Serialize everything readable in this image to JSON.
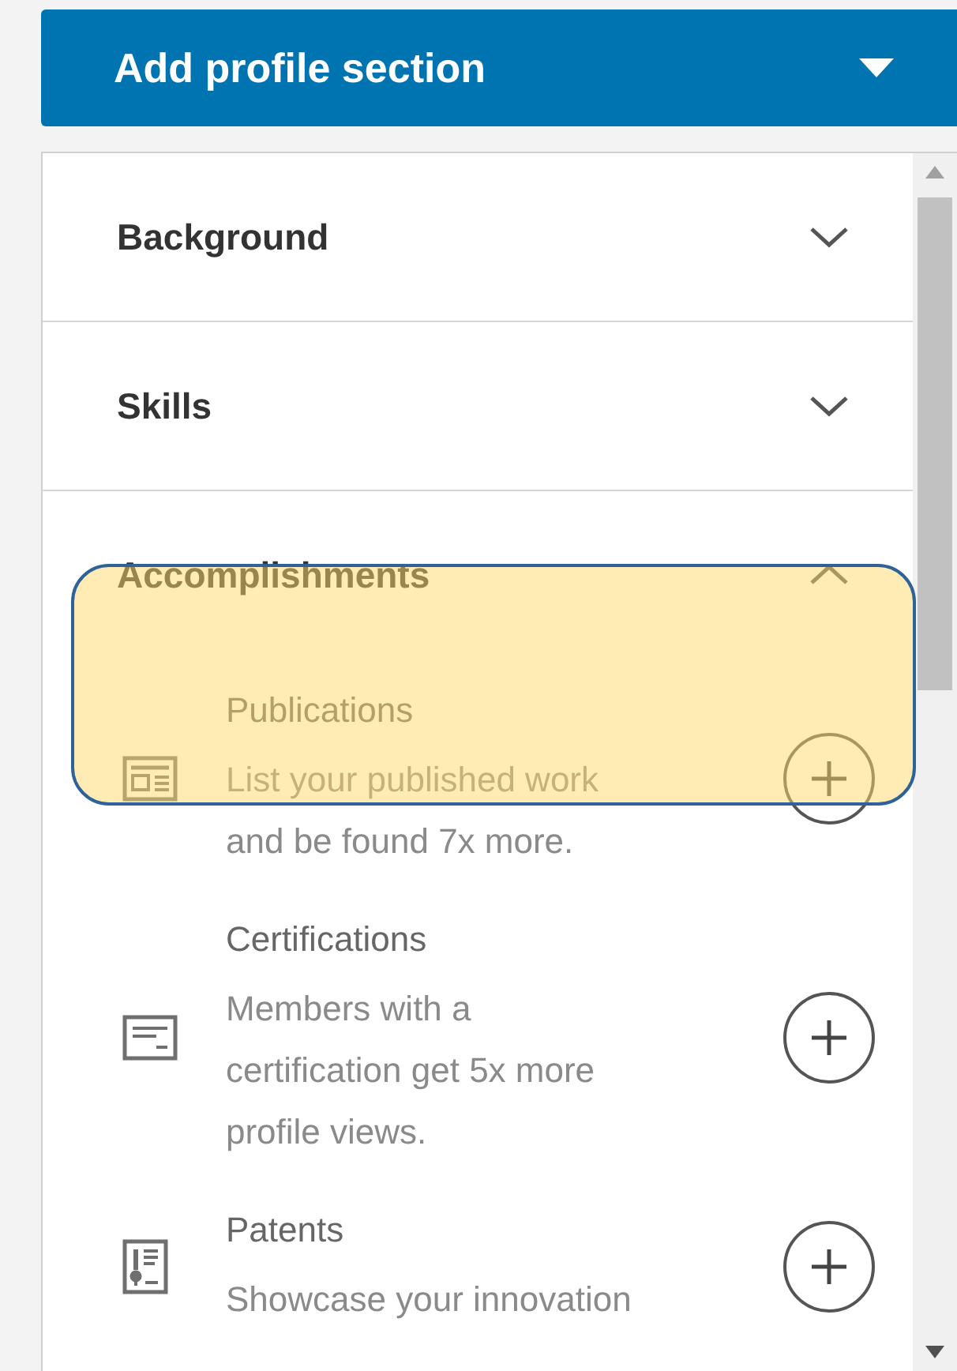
{
  "header_button": {
    "label": "Add profile section"
  },
  "sections": [
    {
      "title": "Background",
      "expanded": false
    },
    {
      "title": "Skills",
      "expanded": false
    },
    {
      "title": "Accomplishments",
      "expanded": true,
      "items": [
        {
          "kind": "publication",
          "title": "Publications",
          "description": "List your published work and be found 7x more."
        },
        {
          "kind": "certification",
          "title": "Certifications",
          "description": "Members with a certification get 5x more profile views."
        },
        {
          "kind": "patent",
          "title": "Patents",
          "description": "Showcase your innovation"
        }
      ]
    }
  ]
}
